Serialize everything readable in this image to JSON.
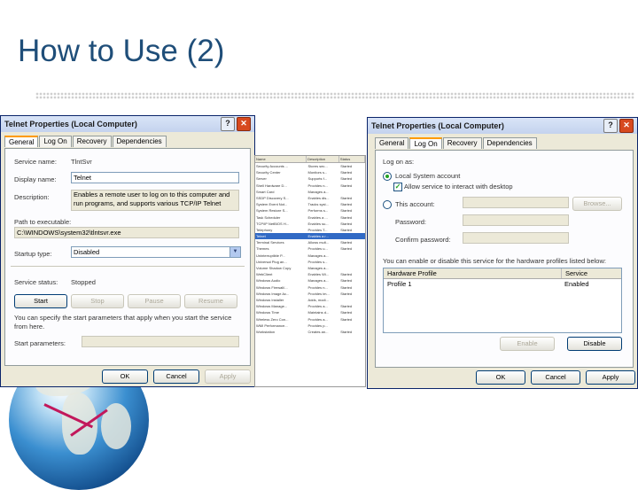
{
  "slide": {
    "title": "How to Use (2)"
  },
  "left_dialog": {
    "title": "Telnet Properties (Local Computer)",
    "help": "?",
    "close": "✕",
    "tabs": [
      "General",
      "Log On",
      "Recovery",
      "Dependencies"
    ],
    "service_name_label": "Service name:",
    "service_name_value": "TlntSvr",
    "display_name_label": "Display name:",
    "display_name_value": "Telnet",
    "description_label": "Description:",
    "description_value_line1": "Enables a remote user to log on to this computer and",
    "description_value_line2": "run programs, and supports various TCP/IP Telnet",
    "path_label": "Path to executable:",
    "path_value": "C:\\WINDOWS\\system32\\tlntsvr.exe",
    "startup_label": "Startup type:",
    "startup_value": "Disabled",
    "status_label": "Service status:",
    "status_value": "Stopped",
    "btn_start": "Start",
    "btn_stop": "Stop",
    "btn_pause": "Pause",
    "btn_resume": "Resume",
    "params_note_line1": "You can specify the start parameters that apply when you start the service",
    "params_note_line2": "from here.",
    "params_label": "Start parameters:",
    "ok": "OK",
    "cancel": "Cancel",
    "apply": "Apply"
  },
  "services_list": {
    "columns": [
      "Name",
      "Description",
      "Status"
    ],
    "rows": [
      [
        "Security Accounts ...",
        "Stores sec...",
        "Started"
      ],
      [
        "Security Center",
        "Monitors s...",
        "Started"
      ],
      [
        "Server",
        "Supports f...",
        "Started"
      ],
      [
        "Shell Hardware D...",
        "Provides n...",
        "Started"
      ],
      [
        "Smart Card",
        "Manages a...",
        ""
      ],
      [
        "SSDP Discovery S...",
        "Enables dis...",
        "Started"
      ],
      [
        "System Event Not...",
        "Tracks syst...",
        "Started"
      ],
      [
        "System Restore S...",
        "Performs s...",
        "Started"
      ],
      [
        "Task Scheduler",
        "Enables a ...",
        "Started"
      ],
      [
        "TCP/IP NetBIOS H...",
        "Enables su...",
        "Started"
      ],
      [
        "Telephony",
        "Provides T...",
        "Started"
      ],
      [
        "Telnet",
        "Enables a r...",
        ""
      ],
      [
        "Terminal Services",
        "Allows mult...",
        "Started"
      ],
      [
        "Themes",
        "Provides u...",
        "Started"
      ],
      [
        "Uninterruptible P...",
        "Manages a...",
        ""
      ],
      [
        "Universal Plug an...",
        "Provides s...",
        ""
      ],
      [
        "Volume Shadow Copy",
        "Manages a...",
        ""
      ],
      [
        "WebClient",
        "Enables Wi...",
        "Started"
      ],
      [
        "Windows Audio",
        "Manages a...",
        "Started"
      ],
      [
        "Windows Firewall/...",
        "Provides n...",
        "Started"
      ],
      [
        "Windows Image Ac...",
        "Provides im...",
        "Started"
      ],
      [
        "Windows Installer",
        "Adds, modi...",
        ""
      ],
      [
        "Windows Manage...",
        "Provides a...",
        "Started"
      ],
      [
        "Windows Time",
        "Maintains d...",
        "Started"
      ],
      [
        "Wireless Zero Con...",
        "Provides a...",
        "Started"
      ],
      [
        "WMI Performance...",
        "Provides p...",
        ""
      ],
      [
        "Workstation",
        "Creates an...",
        "Started"
      ]
    ]
  },
  "right_dialog": {
    "title": "Telnet Properties (Local Computer)",
    "help": "?",
    "close": "✕",
    "tabs": [
      "General",
      "Log On",
      "Recovery",
      "Dependencies"
    ],
    "logon_as_label": "Log on as:",
    "local_system_label": "Local System account",
    "interact_label": "Allow service to interact with desktop",
    "this_account_label": "This account:",
    "browse": "Browse...",
    "password_label": "Password:",
    "confirm_label": "Confirm password:",
    "profiles_note": "You can enable or disable this service for the hardware profiles listed below:",
    "hw_col_profile": "Hardware Profile",
    "hw_col_service": "Service",
    "hw_row_profile": "Profile 1",
    "hw_row_service": "Enabled",
    "enable": "Enable",
    "disable": "Disable",
    "ok": "OK",
    "cancel": "Cancel",
    "apply": "Apply"
  }
}
